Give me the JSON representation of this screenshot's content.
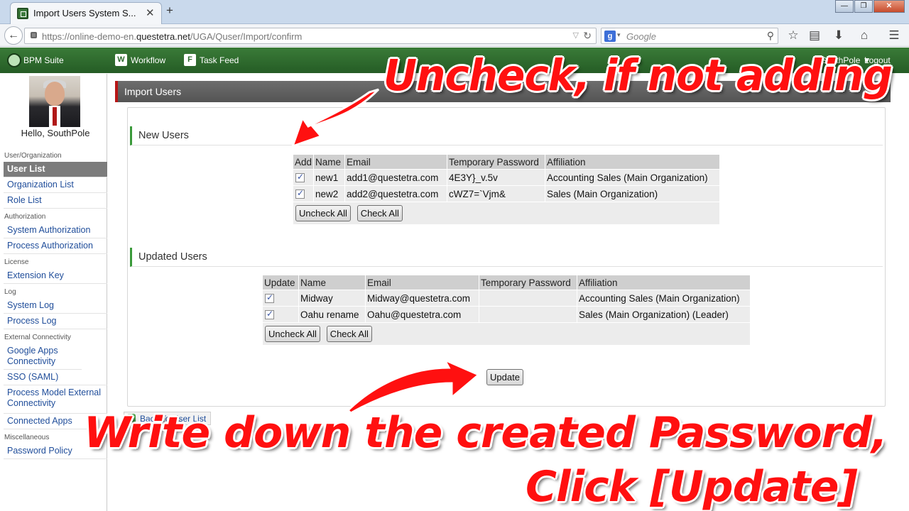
{
  "browser": {
    "tab_title": "Import Users System S...",
    "tab_close": "✕",
    "new_tab": "+",
    "url_prefix": "https://online-demo-en.",
    "url_domain": "questetra.net",
    "url_path": "/UGA/Quser/Import/confirm",
    "search_engine": "g",
    "search_placeholder": "Google",
    "window_buttons": [
      "—",
      "❐",
      "✕"
    ]
  },
  "app_header": {
    "logo": "BPM Suite",
    "nav": [
      {
        "icon": "W",
        "label": "Workflow"
      },
      {
        "icon": "F",
        "label": "Task Feed"
      }
    ],
    "user_menu": "SouthPole ▼",
    "logout": "Logout"
  },
  "sidebar": {
    "greeting": "Hello, SouthPole",
    "groups": [
      {
        "section": "User/Organization",
        "items": [
          "User List",
          "Organization List",
          "Role List"
        ]
      },
      {
        "section": "Authorization",
        "items": [
          "System Authorization",
          "Process Authorization"
        ]
      },
      {
        "section": "License",
        "items": [
          "Extension Key"
        ]
      },
      {
        "section": "Log",
        "items": [
          "System Log",
          "Process Log"
        ]
      },
      {
        "section": "External Connectivity",
        "items": [
          "Google Apps Connectivity",
          "SSO (SAML)",
          "Process Model External Connectivity",
          "Connected Apps"
        ]
      },
      {
        "section": "Miscellaneous",
        "items": [
          "Password Policy"
        ]
      }
    ],
    "active_item": "User List"
  },
  "page": {
    "title": "Import Users",
    "new_users": {
      "title": "New Users",
      "headers": [
        "Add",
        "Name",
        "Email",
        "Temporary Password",
        "Affiliation"
      ],
      "rows": [
        {
          "checked": true,
          "name": "new1",
          "email": "add1@questetra.com",
          "password": "4E3Y}_v.5v",
          "affiliation": "Accounting Sales (Main Organization)"
        },
        {
          "checked": true,
          "name": "new2",
          "email": "add2@questetra.com",
          "password": "cWZ7=`Vjm&",
          "affiliation": "Sales (Main Organization)"
        }
      ],
      "uncheck_all": "Uncheck All",
      "check_all": "Check All"
    },
    "updated_users": {
      "title": "Updated Users",
      "headers": [
        "Update",
        "Name",
        "Email",
        "Temporary Password",
        "Affiliation"
      ],
      "rows": [
        {
          "checked": true,
          "name": "Midway",
          "email": "Midway@questetra.com",
          "password": "",
          "affiliation": "Accounting Sales (Main Organization)"
        },
        {
          "checked": true,
          "name": "Oahu rename",
          "email": "Oahu@questetra.com",
          "password": "",
          "affiliation": "Sales (Main Organization) (Leader)"
        }
      ],
      "uncheck_all": "Uncheck All",
      "check_all": "Check All"
    },
    "update_button": "Update",
    "back_link": "Back To User List"
  },
  "annotations": {
    "top": "Uncheck, if not adding",
    "bottom_line1": "Write down the created Password,",
    "bottom_line2": "Click [Update]",
    "color": "#ff1010"
  }
}
